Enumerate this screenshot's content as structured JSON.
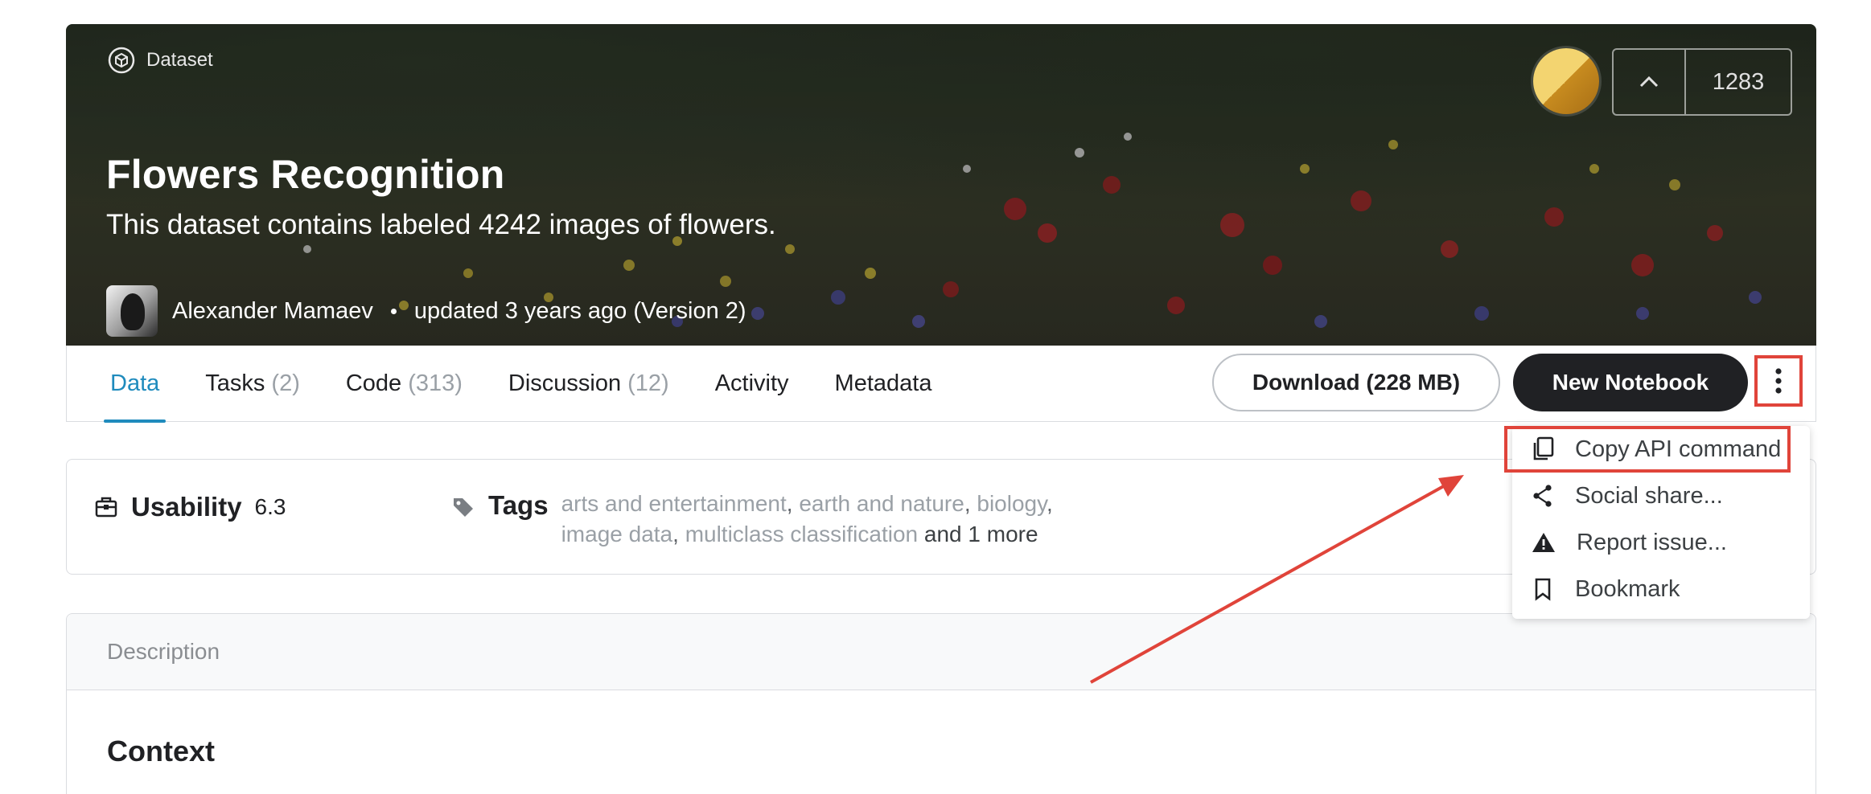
{
  "hero": {
    "kind_label": "Dataset",
    "title": "Flowers Recognition",
    "subtitle": "This dataset contains labeled 4242 images of flowers.",
    "author": "Alexander Mamaev",
    "updated": "updated 3 years ago (Version 2)",
    "vote_count": "1283"
  },
  "tabs": [
    {
      "label": "Data",
      "count": ""
    },
    {
      "label": "Tasks",
      "count": "(2)"
    },
    {
      "label": "Code",
      "count": "(313)"
    },
    {
      "label": "Discussion",
      "count": "(12)"
    },
    {
      "label": "Activity",
      "count": ""
    },
    {
      "label": "Metadata",
      "count": ""
    }
  ],
  "actions": {
    "download_label": "Download (228 MB)",
    "new_notebook_label": "New Notebook"
  },
  "usability": {
    "label": "Usability",
    "value": "6.3"
  },
  "tags": {
    "label": "Tags",
    "items": [
      "arts and entertainment",
      "earth and nature",
      "biology",
      "image data",
      "multiclass classification"
    ],
    "more": "and 1 more"
  },
  "description": {
    "header": "Description",
    "first_heading": "Context"
  },
  "menu": {
    "items": [
      {
        "label": "Copy API command",
        "icon": "copy-icon"
      },
      {
        "label": "Social share...",
        "icon": "share-icon"
      },
      {
        "label": "Report issue...",
        "icon": "warning-icon"
      },
      {
        "label": "Bookmark",
        "icon": "bookmark-icon"
      }
    ]
  },
  "colors": {
    "active_tab": "#1f8bbd",
    "annotation_red": "#e0443a",
    "primary_button": "#202124"
  }
}
